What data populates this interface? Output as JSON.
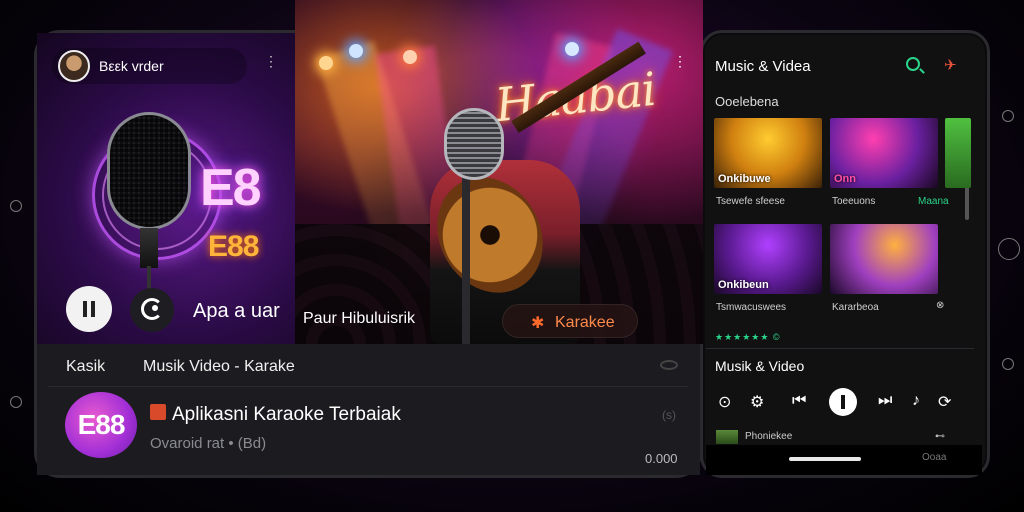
{
  "left_app": {
    "topbar_title": "Bεεk vrder",
    "brand_big": "E8",
    "brand_small": "E88",
    "side_label": "Apa a uar"
  },
  "video": {
    "neon_title": "Haabai",
    "caption": "Paur Hibuluisrik",
    "karaoke_button": "Karakee"
  },
  "bottom": {
    "tabs": [
      "Kasik",
      "Musik Video - Karake"
    ],
    "app_logo": "E88",
    "app_title": "Aplikasni Karaoke Terbaiak",
    "app_subtitle": "Ovaroid rat • (Bd)",
    "count": "0.000"
  },
  "right_app": {
    "title": "Music & Videa",
    "section": "Ooelebena",
    "thumbs": [
      {
        "label": "Onkibuwe",
        "caption": "Tsewefe sfeese"
      },
      {
        "label": "Onn",
        "caption": "Toeeuons",
        "caption2": "Maana"
      },
      {
        "label": "Onkibeun",
        "caption": "Tsmwacuswees"
      },
      {
        "label": "",
        "caption": "Kararbeoa"
      }
    ],
    "rating_text": "★★★★★★ ©",
    "player_title": "Musik & Video",
    "mini_label": "Phoniekee",
    "footer_text": "Ooaa"
  },
  "icons": [
    "search-icon",
    "pin-icon",
    "pause-icon",
    "repeat-icon",
    "mic-icon",
    "prev-icon",
    "next-icon",
    "play-icon"
  ]
}
